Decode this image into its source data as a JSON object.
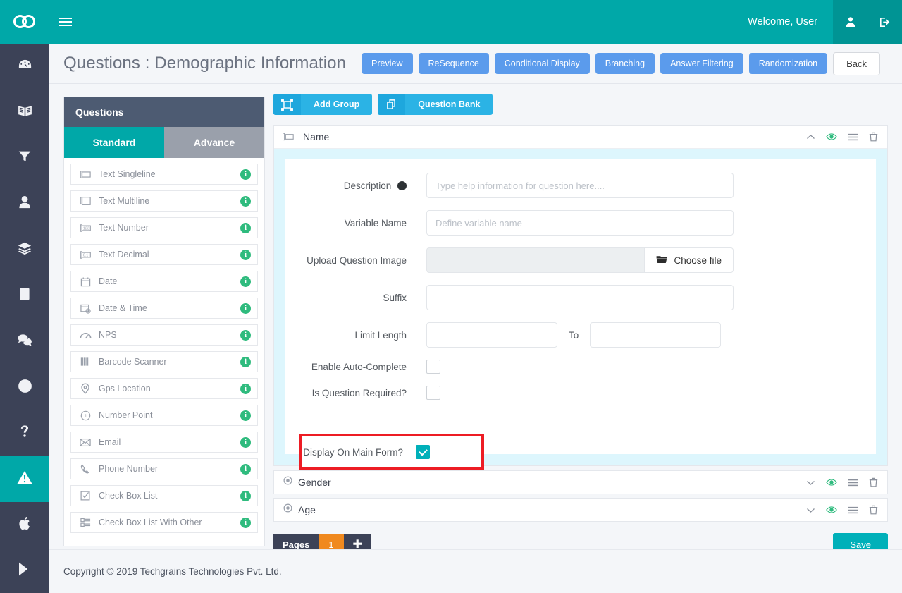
{
  "topbar": {
    "logo_name": "go-logo",
    "menu_toggle": "hamburger-icon",
    "welcome": "Welcome, User",
    "user_icon": "user-icon",
    "logout_icon": "logout-icon"
  },
  "rail": {
    "items": [
      {
        "icon": "dashboard-icon",
        "active": false
      },
      {
        "icon": "book-icon",
        "active": false
      },
      {
        "icon": "filter-icon",
        "active": false
      },
      {
        "icon": "user-icon",
        "active": false
      },
      {
        "icon": "layers-icon",
        "active": false
      },
      {
        "icon": "tablet-icon",
        "active": false
      },
      {
        "icon": "chat-icon",
        "active": false
      },
      {
        "icon": "lifebuoy-icon",
        "active": false
      },
      {
        "icon": "question-mark-icon",
        "active": false
      },
      {
        "icon": "warning-triangle-icon",
        "active": true
      },
      {
        "icon": "apple-icon",
        "active": false
      },
      {
        "icon": "play-store-icon",
        "active": false
      }
    ]
  },
  "page": {
    "title": "Questions : Demographic Information",
    "buttons": [
      {
        "label": "Preview",
        "style": "blue"
      },
      {
        "label": "ReSequence",
        "style": "blue"
      },
      {
        "label": "Conditional Display",
        "style": "blue"
      },
      {
        "label": "Branching",
        "style": "blue"
      },
      {
        "label": "Answer Filtering",
        "style": "blue"
      },
      {
        "label": "Randomization",
        "style": "blue"
      }
    ],
    "back_label": "Back"
  },
  "question_panel": {
    "header": "Questions",
    "tabs": [
      {
        "label": "Standard",
        "active": true
      },
      {
        "label": "Advance",
        "active": false
      }
    ],
    "info_glyph": "i",
    "items": [
      {
        "label": "Text Singleline",
        "icon": "text-singleline-icon"
      },
      {
        "label": "Text Multiline",
        "icon": "text-multiline-icon"
      },
      {
        "label": "Text Number",
        "icon": "text-number-icon"
      },
      {
        "label": "Text Decimal",
        "icon": "text-decimal-icon"
      },
      {
        "label": "Date",
        "icon": "calendar-icon"
      },
      {
        "label": "Date & Time",
        "icon": "calendar-clock-icon"
      },
      {
        "label": "NPS",
        "icon": "gauge-icon"
      },
      {
        "label": "Barcode Scanner",
        "icon": "barcode-icon"
      },
      {
        "label": "Gps Location",
        "icon": "map-pin-icon"
      },
      {
        "label": "Number Point",
        "icon": "number-point-icon"
      },
      {
        "label": "Email",
        "icon": "envelope-icon"
      },
      {
        "label": "Phone Number",
        "icon": "phone-icon"
      },
      {
        "label": "Check Box List",
        "icon": "checkbox-icon"
      },
      {
        "label": "Check Box List With Other",
        "icon": "checkbox-list-icon"
      }
    ]
  },
  "toolbar": {
    "add_group_label": "Add Group",
    "add_group_icon": "group-icon",
    "question_bank_label": "Question Bank",
    "question_bank_icon": "copy-icon"
  },
  "active_question": {
    "title": "Name",
    "type_icon": "text-singleline-icon",
    "actions": [
      {
        "icon": "chevron-up-icon"
      },
      {
        "icon": "eye-icon"
      },
      {
        "icon": "hamburger-icon"
      },
      {
        "icon": "trash-icon"
      }
    ],
    "fields": {
      "description_label": "Description",
      "description_info_icon": "info-icon",
      "description_placeholder": "Type help information for question here....",
      "description_value": "",
      "variable_label": "Variable Name",
      "variable_placeholder": "Define variable name",
      "variable_value": "",
      "upload_label": "Upload Question Image",
      "choose_file_label": "Choose file",
      "choose_file_icon": "folder-icon",
      "suffix_label": "Suffix",
      "suffix_value": "",
      "limit_length_label": "Limit Length",
      "limit_from_value": "",
      "to_label": "To",
      "limit_to_value": "",
      "auto_complete_label": "Enable Auto-Complete",
      "auto_complete_checked": false,
      "required_label": "Is Question Required?",
      "required_checked": false,
      "display_main_label": "Display On Main Form?",
      "display_main_checked": true
    }
  },
  "other_questions": [
    {
      "title": "Gender",
      "type_icon": "radio-icon",
      "actions": [
        {
          "icon": "chevron-down-icon"
        },
        {
          "icon": "eye-icon"
        },
        {
          "icon": "hamburger-icon"
        },
        {
          "icon": "trash-icon"
        }
      ]
    },
    {
      "title": "Age",
      "type_icon": "radio-icon",
      "actions": [
        {
          "icon": "chevron-down-icon"
        },
        {
          "icon": "eye-icon"
        },
        {
          "icon": "hamburger-icon"
        },
        {
          "icon": "trash-icon"
        }
      ]
    }
  ],
  "pager": {
    "label": "Pages",
    "current_page": "1",
    "add_glyph": "✚"
  },
  "save_label": "Save",
  "footer": {
    "copyright": "Copyright © 2019 Techgrains Technologies Pvt. Ltd."
  },
  "colors": {
    "brand_teal": "#00a8a8",
    "rail_dark": "#3c4257",
    "blue_button": "#5b9bec",
    "toolbar_blue": "#2bb3e5",
    "panel_head": "#4d5b72",
    "card_body_cyan": "#ddf6fd",
    "info_green": "#2fbb7e",
    "highlight_red": "#ed1c24",
    "pager_orange": "#f0891e",
    "save_teal": "#00b0b9"
  }
}
